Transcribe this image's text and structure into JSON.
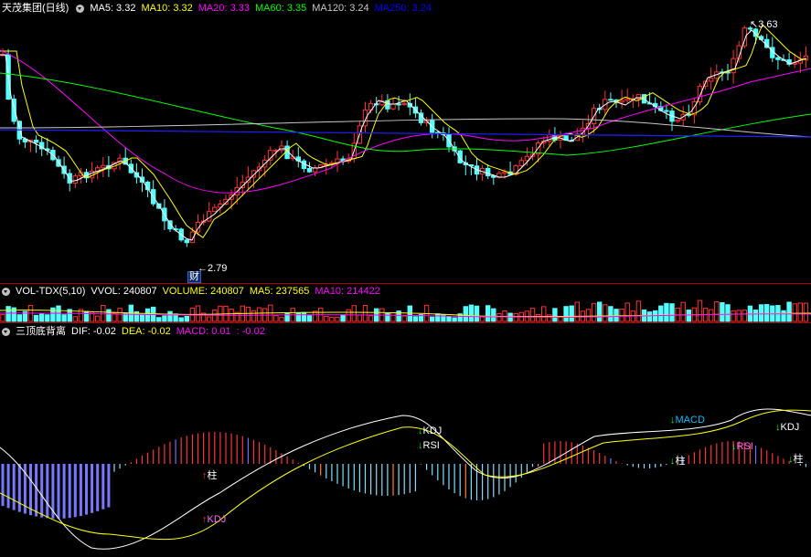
{
  "price_panel": {
    "title": "天茂集团(日线)",
    "ma_labels": [
      {
        "text": "MA5: 3.32",
        "color": "#ffffff"
      },
      {
        "text": "MA10: 3.32",
        "color": "#ffff00"
      },
      {
        "text": "MA20: 3.33",
        "color": "#ff00ff"
      },
      {
        "text": "MA60: 3.35",
        "color": "#00ff00"
      },
      {
        "text": "MA120: 3.24",
        "color": "#c8c8c8"
      },
      {
        "text": "MA250: 3.24",
        "color": "#0000ff"
      }
    ],
    "high_marker": "3.63",
    "low_marker": "2.79",
    "low_badge": "财"
  },
  "volume_panel": {
    "title": "VOL-TDX(5,10)",
    "labels": [
      {
        "text": "VVOL: 240807",
        "color": "#ffffff"
      },
      {
        "text": "VOLUME: 240807",
        "color": "#ffff00"
      },
      {
        "text": "MA5: 237565",
        "color": "#ffff00"
      },
      {
        "text": "MA10: 214422",
        "color": "#ff00ff"
      }
    ]
  },
  "macd_panel": {
    "title": "三顶底背离",
    "labels": [
      {
        "text": "DIF: -0.02",
        "color": "#ffffff"
      },
      {
        "text": "DEA: -0.02",
        "color": "#ffff00"
      },
      {
        "text": "MACD: 0.01",
        "color": "#ff00ff"
      },
      {
        "text": ": -0.02",
        "color": "#ff00ff"
      }
    ],
    "signals": [
      {
        "text": "柱",
        "color": "#ffffff",
        "arrow": "up"
      },
      {
        "text": "KDJ",
        "color": "#ff66ff",
        "arrow": "up"
      },
      {
        "text": "KDJ",
        "color": "#ffffff",
        "arrow": "down"
      },
      {
        "text": "RSI",
        "color": "#ffffff",
        "arrow": "down"
      },
      {
        "text": "MACD",
        "color": "#00c0ff",
        "arrow": "down"
      },
      {
        "text": "柱",
        "color": "#ffffff",
        "arrow": "down"
      },
      {
        "text": "RSI",
        "color": "#ff66ff",
        "arrow": "down"
      },
      {
        "text": "KDJ",
        "color": "#ffffff",
        "arrow": "down"
      },
      {
        "text": "柱",
        "color": "#ffffff",
        "arrow": "down"
      }
    ]
  },
  "colors": {
    "up": "#ff3232",
    "down": "#54ffff",
    "grid": "#b00000",
    "bg": "#000000"
  }
}
